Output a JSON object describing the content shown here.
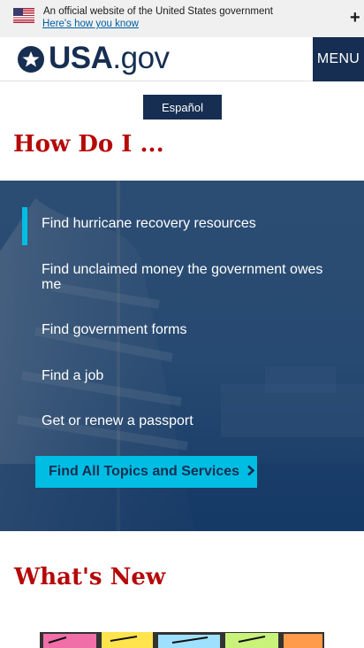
{
  "banner": {
    "official_text": "An official website of the United States government",
    "how_you_know": "Here's how you know",
    "expand_icon": "plus-icon"
  },
  "header": {
    "logo_text": "USA",
    "logo_suffix": ".gov",
    "menu_label": "MENU"
  },
  "language_toggle": "Español",
  "how_do_i": {
    "title": "How Do I ...",
    "items": [
      "Find hurricane recovery resources",
      "Find unclaimed money the government owes me",
      "Find government forms",
      "Find a job",
      "Get or renew a passport"
    ],
    "cta_label": "Find All Topics and Services",
    "cta_icon": "chevron-right-icon"
  },
  "whats_new": {
    "title": "What's New"
  },
  "colors": {
    "navy": "#162e51",
    "cyan": "#00bde3",
    "heading_red": "#b50909",
    "banner_bg": "#f0f0f0"
  }
}
